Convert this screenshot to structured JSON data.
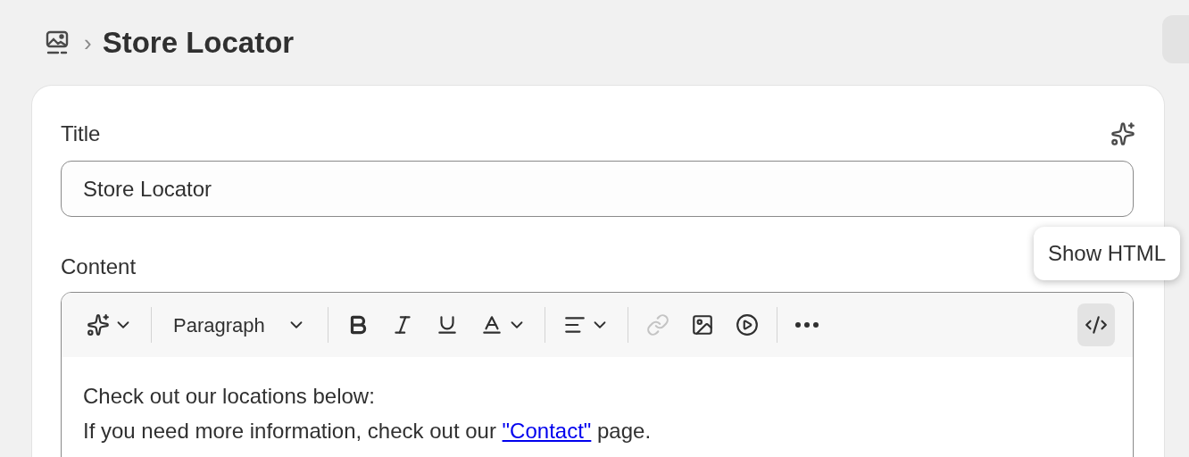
{
  "breadcrumb": {
    "separator": "›",
    "title": "Store Locator"
  },
  "form": {
    "title_label": "Title",
    "title_value": "Store Locator",
    "content_label": "Content",
    "toolbar": {
      "groups": [
        [
          {
            "kind": "sparkle",
            "disabled": false,
            "active": false
          }
        ],
        [
          {
            "kind": "select",
            "label": "Paragraph",
            "disabled": false,
            "active": false
          }
        ],
        [
          {
            "kind": "bold",
            "disabled": false,
            "active": false
          },
          {
            "kind": "italic",
            "disabled": false,
            "active": false
          },
          {
            "kind": "underline",
            "disabled": false,
            "active": false
          },
          {
            "kind": "color",
            "disabled": false,
            "active": false
          }
        ],
        [
          {
            "kind": "align",
            "disabled": false,
            "active": false
          }
        ],
        [
          {
            "kind": "link",
            "disabled": true,
            "active": false
          },
          {
            "kind": "image",
            "disabled": false,
            "active": false
          },
          {
            "kind": "video",
            "disabled": false,
            "active": false
          }
        ],
        [
          {
            "kind": "more",
            "disabled": false,
            "active": false
          }
        ],
        [
          {
            "kind": "html",
            "disabled": false,
            "active": true
          }
        ]
      ]
    },
    "tooltip": "Show HTML",
    "paragraphs": [
      {
        "before": "Check out our locations below:"
      },
      {
        "before": "If you need more information, check out our ",
        "link": "\"Contact\"",
        "after": " page."
      }
    ]
  }
}
